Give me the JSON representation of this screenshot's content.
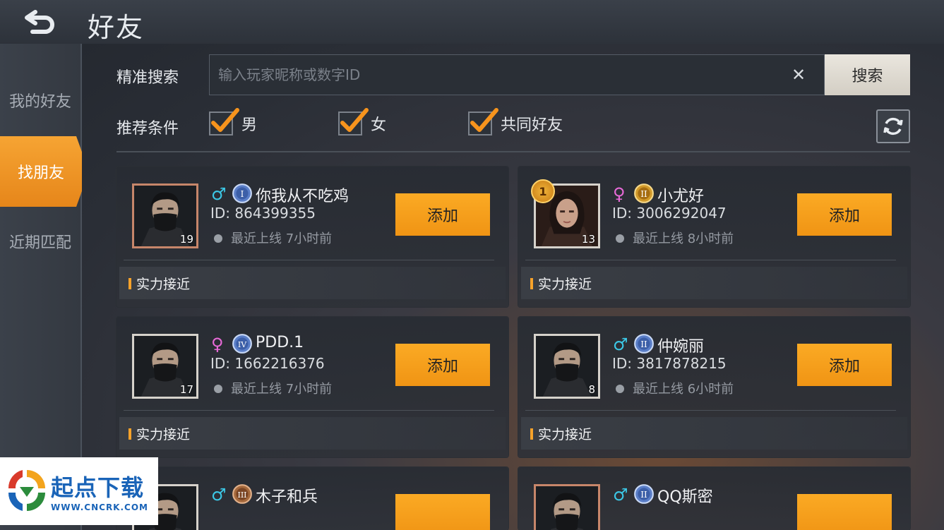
{
  "page": {
    "title": "好友"
  },
  "sidebar": {
    "items": [
      {
        "label": "我的好友"
      },
      {
        "label": "找朋友"
      },
      {
        "label": "近期匹配"
      }
    ]
  },
  "search": {
    "label": "精准搜索",
    "placeholder": "输入玩家昵称或数字ID",
    "value": "",
    "button": "搜索"
  },
  "filters": {
    "label": "推荐条件",
    "options": [
      {
        "label": "男",
        "checked": true
      },
      {
        "label": "女",
        "checked": true
      },
      {
        "label": "共同好友",
        "checked": true
      }
    ]
  },
  "cards": [
    {
      "name": "你我从不吃鸡",
      "id": "ID: 864399355",
      "gender": "♂",
      "rank": "I",
      "level": "19",
      "status": "最近上线 7小时前",
      "button": "添加",
      "tag": "实力接近"
    },
    {
      "name": "小尤好",
      "id": "ID: 3006292047",
      "gender": "♀",
      "rank": "II",
      "level": "13",
      "status": "最近上线 8小时前",
      "button": "添加",
      "tag": "实力接近",
      "medal": "1"
    },
    {
      "name": "PDD.1",
      "id": "ID: 1662216376",
      "gender": "♀",
      "rank": "IV",
      "level": "17",
      "status": "最近上线 7小时前",
      "button": "添加",
      "tag": "实力接近"
    },
    {
      "name": "仲婉丽",
      "id": "ID: 3817878215",
      "gender": "♂",
      "rank": "II",
      "level": "8",
      "status": "最近上线 6小时前",
      "button": "添加",
      "tag": "实力接近"
    },
    {
      "name": "木子和兵",
      "gender": "♂",
      "rank": "III"
    },
    {
      "name": "QQ斯密",
      "gender": "♂",
      "rank": "II"
    }
  ],
  "watermark": {
    "title": "起点下载",
    "url": "WWW.CNCRK.COM"
  },
  "colors": {
    "accent": "#f6a22a",
    "male": "#3cc8e6",
    "female": "#e86ad8"
  }
}
